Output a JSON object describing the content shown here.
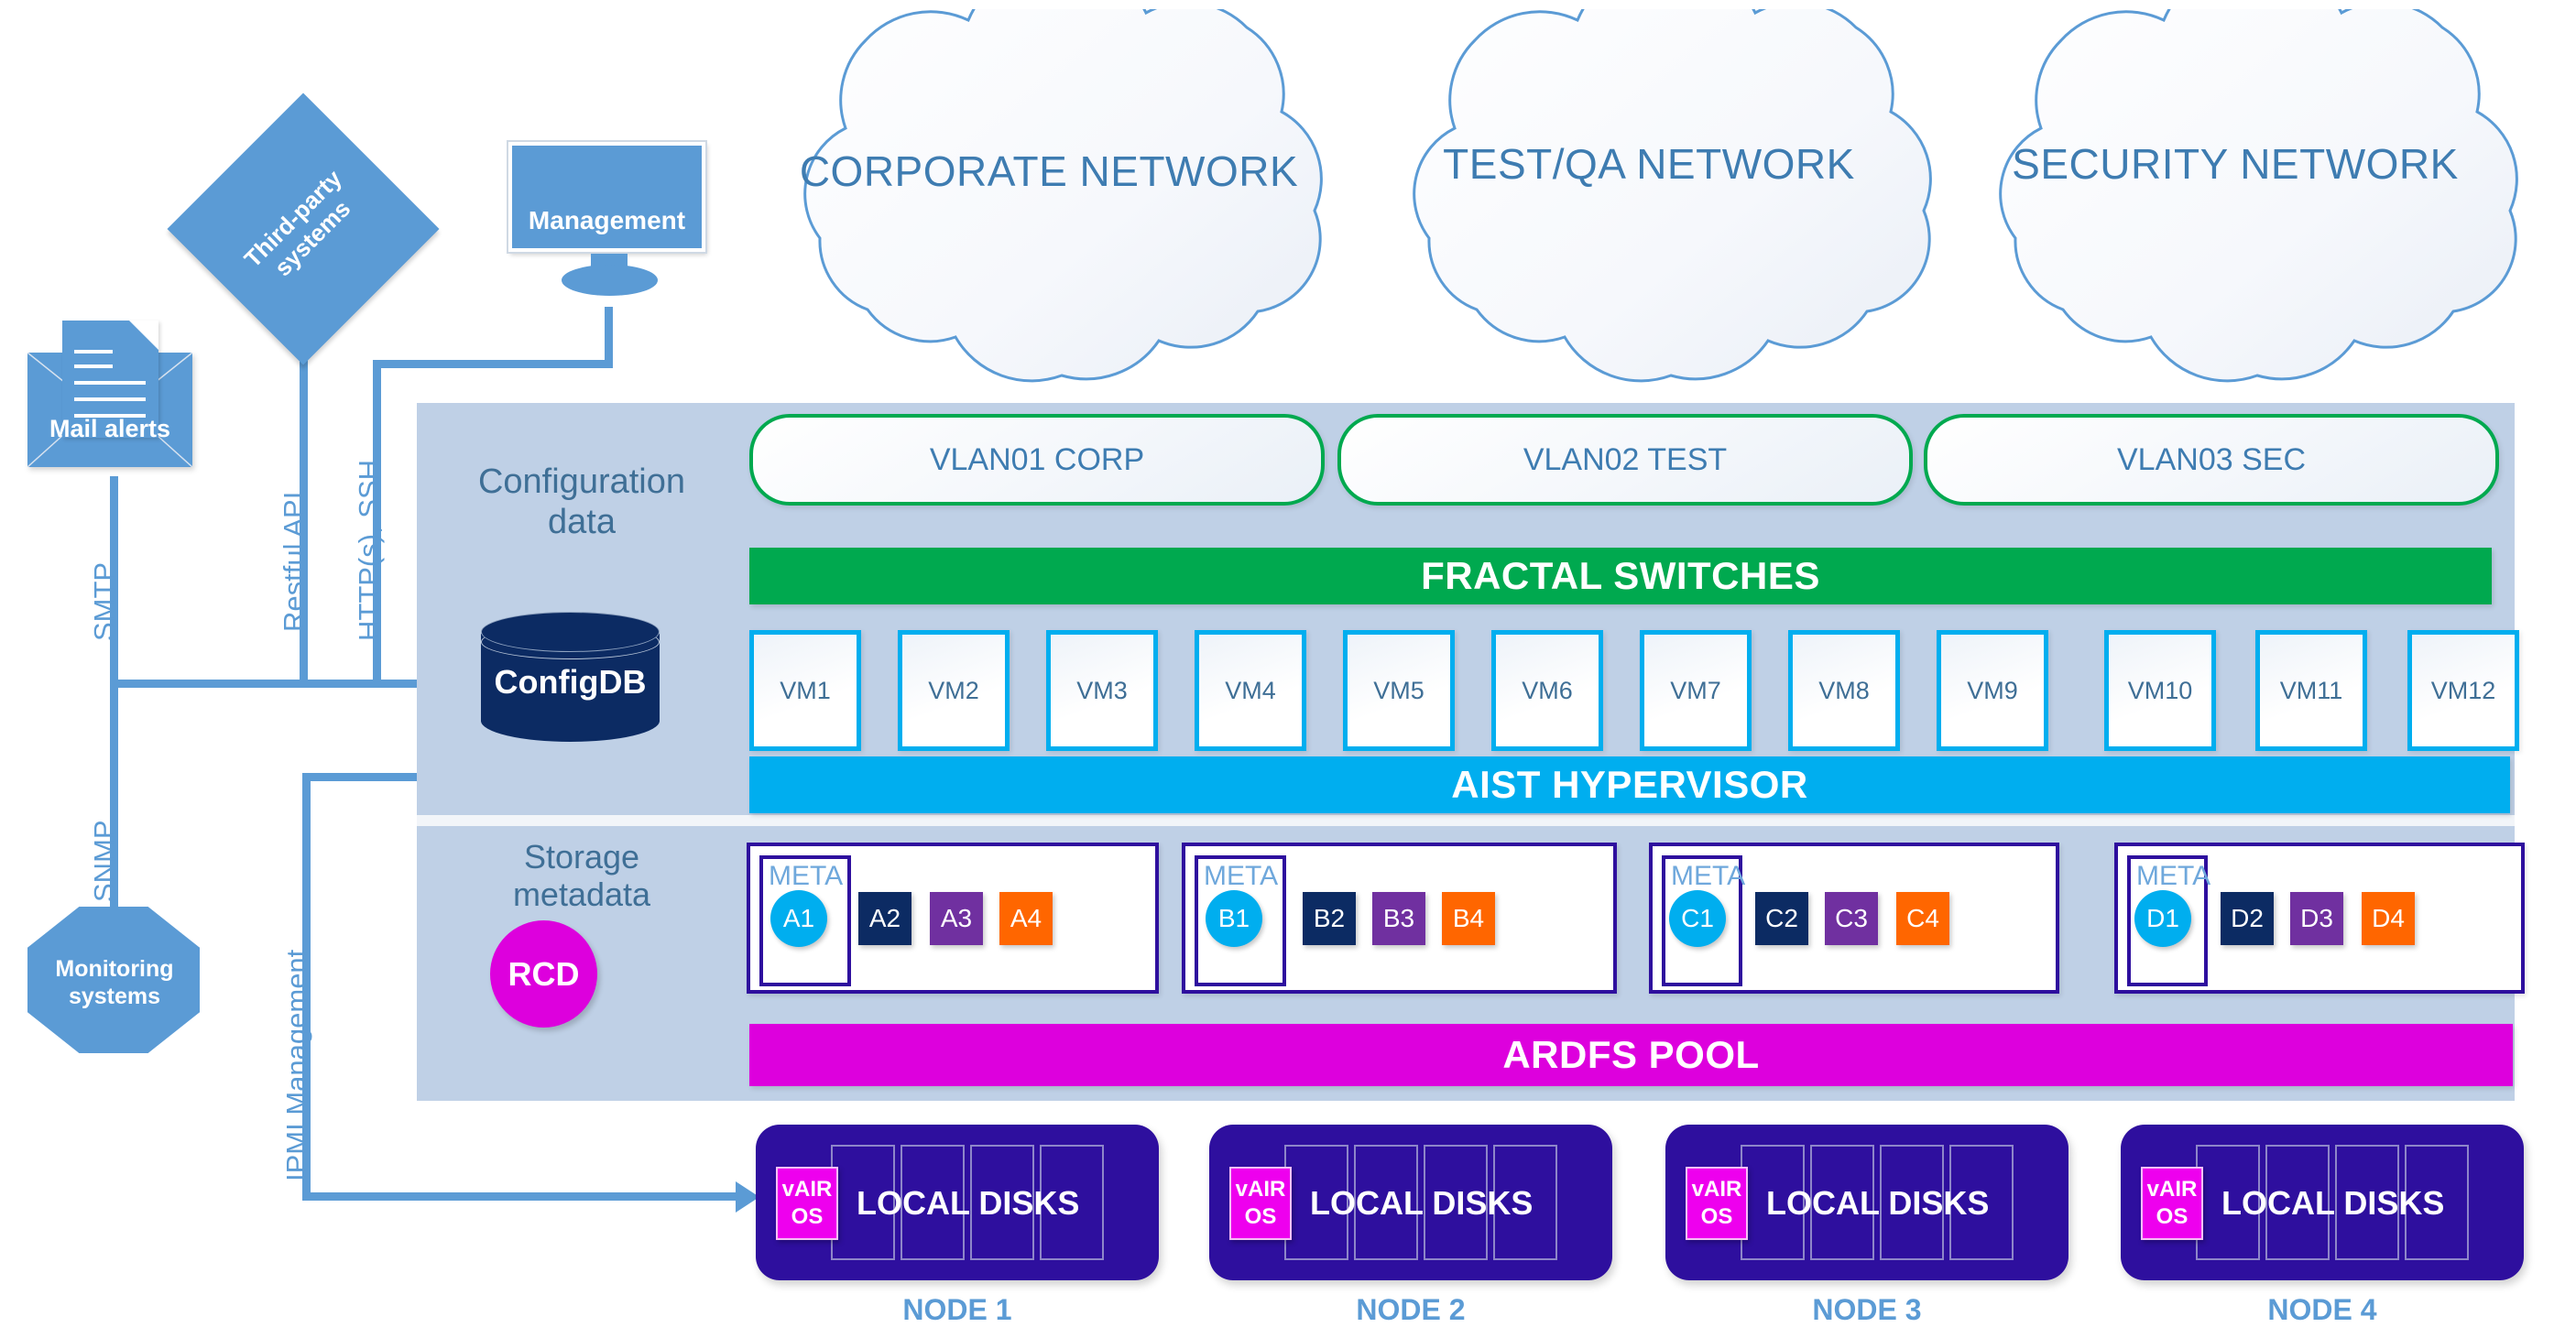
{
  "external": {
    "third_party": "Third-party\nsystems",
    "third_party_l1": "Third-party",
    "third_party_l2": "systems",
    "mail_alerts": "Mail alerts",
    "monitoring_l1": "Monitoring",
    "monitoring_l2": "systems",
    "management": "Management"
  },
  "protocols": {
    "smtp": "SMTP",
    "restful_api": "Restful API",
    "https_ssh": "HTTP(s), SSH",
    "snmp": "SNMP",
    "ipmi": "IPMI Management"
  },
  "clouds": [
    {
      "label": "CORPORATE NETWORK"
    },
    {
      "label": "TEST/QA NETWORK"
    },
    {
      "label": "SECURITY NETWORK"
    }
  ],
  "platform": {
    "config_label_l1": "Configuration",
    "config_label_l2": "data",
    "storage_label_l1": "Storage",
    "storage_label_l2": "metadata",
    "configdb": "ConfigDB",
    "rcd": "RCD",
    "vlans": [
      {
        "label": "VLAN01 CORP"
      },
      {
        "label": "VLAN02 TEST"
      },
      {
        "label": "VLAN03 SEC"
      }
    ],
    "switches_bar": "FRACTAL SWITCHES",
    "hypervisor_bar": "AIST HYPERVISOR",
    "pool_bar": "ARDFS POOL",
    "vms": [
      {
        "label": "VM1"
      },
      {
        "label": "VM2"
      },
      {
        "label": "VM3"
      },
      {
        "label": "VM4"
      },
      {
        "label": "VM5"
      },
      {
        "label": "VM6"
      },
      {
        "label": "VM7"
      },
      {
        "label": "VM8"
      },
      {
        "label": "VM9"
      },
      {
        "label": "VM10"
      },
      {
        "label": "VM11"
      },
      {
        "label": "VM12"
      }
    ],
    "meta_caption": "META",
    "meta_groups": [
      {
        "caption": "META",
        "chunks": [
          {
            "label": "A1",
            "shape": "circle",
            "color": "#00AEEF"
          },
          {
            "label": "A2",
            "shape": "square",
            "color": "#0C2B63"
          },
          {
            "label": "A3",
            "shape": "square",
            "color": "#7030A0"
          },
          {
            "label": "A4",
            "shape": "square",
            "color": "#FF6600"
          }
        ]
      },
      {
        "caption": "META",
        "chunks": [
          {
            "label": "B1",
            "shape": "circle",
            "color": "#00AEEF"
          },
          {
            "label": "B2",
            "shape": "square",
            "color": "#0C2B63"
          },
          {
            "label": "B3",
            "shape": "square",
            "color": "#7030A0"
          },
          {
            "label": "B4",
            "shape": "square",
            "color": "#FF6600"
          }
        ]
      },
      {
        "caption": "META",
        "chunks": [
          {
            "label": "C1",
            "shape": "circle",
            "color": "#00AEEF"
          },
          {
            "label": "C2",
            "shape": "square",
            "color": "#0C2B63"
          },
          {
            "label": "C3",
            "shape": "square",
            "color": "#7030A0"
          },
          {
            "label": "C4",
            "shape": "square",
            "color": "#FF6600"
          }
        ]
      },
      {
        "caption": "META",
        "chunks": [
          {
            "label": "D1",
            "shape": "circle",
            "color": "#00AEEF"
          },
          {
            "label": "D2",
            "shape": "square",
            "color": "#0C2B63"
          },
          {
            "label": "D3",
            "shape": "square",
            "color": "#7030A0"
          },
          {
            "label": "D4",
            "shape": "square",
            "color": "#FF6600"
          }
        ]
      }
    ]
  },
  "nodes": [
    {
      "os_l1": "vAIR",
      "os_l2": "OS",
      "disks_label": "LOCAL DISKS",
      "name": "NODE 1"
    },
    {
      "os_l1": "vAIR",
      "os_l2": "OS",
      "disks_label": "LOCAL DISKS",
      "name": "NODE 2"
    },
    {
      "os_l1": "vAIR",
      "os_l2": "OS",
      "disks_label": "LOCAL DISKS",
      "name": "NODE 3"
    },
    {
      "os_l1": "vAIR",
      "os_l2": "OS",
      "disks_label": "LOCAL DISKS",
      "name": "NODE 4"
    }
  ],
  "colors": {
    "accent_blue": "#5B9BD5",
    "panel_blue": "#BFD0E6",
    "green": "#00A94F",
    "cyan": "#00AEEF",
    "magenta": "#DD00DD",
    "deep_purple": "#2E0F9E",
    "navy": "#0C2B63",
    "orange": "#FF6600",
    "violet": "#7030A0",
    "text_blue": "#3E7CB1"
  }
}
